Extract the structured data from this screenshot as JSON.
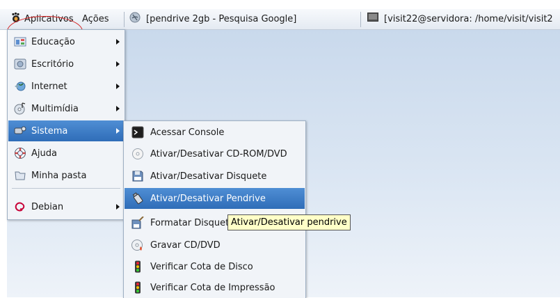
{
  "panel": {
    "apps_label": "Aplicativos",
    "actions_label": "Ações",
    "tasks": [
      {
        "label": "[pendrive 2gb - Pesquisa Google]",
        "icon": "browser-icon"
      },
      {
        "label": "[visit22@servidora: /home/visit/visit2",
        "icon": "terminal-icon"
      }
    ]
  },
  "menu": {
    "items": [
      {
        "label": "Educação",
        "icon": "education-icon",
        "submenu": true
      },
      {
        "label": "Escritório",
        "icon": "office-icon",
        "submenu": true
      },
      {
        "label": "Internet",
        "icon": "internet-icon",
        "submenu": true
      },
      {
        "label": "Multimídia",
        "icon": "multimedia-icon",
        "submenu": true
      },
      {
        "label": "Sistema",
        "icon": "system-icon",
        "submenu": true,
        "selected": true
      },
      {
        "label": "Ajuda",
        "icon": "help-icon",
        "submenu": false
      },
      {
        "label": "Minha pasta",
        "icon": "folder-icon",
        "submenu": false
      },
      {
        "label": "Debian",
        "icon": "debian-icon",
        "submenu": true
      }
    ]
  },
  "submenu": {
    "items": [
      {
        "label": "Acessar Console",
        "icon": "console-icon"
      },
      {
        "label": "Ativar/Desativar CD-ROM/DVD",
        "icon": "cdrom-icon"
      },
      {
        "label": "Ativar/Desativar Disquete",
        "icon": "floppy-icon"
      },
      {
        "label": "Ativar/Desativar Pendrive",
        "icon": "usb-drive-icon",
        "selected": true
      },
      {
        "label": "Formatar Disquete",
        "icon": "format-floppy-icon"
      },
      {
        "label": "Gravar CD/DVD",
        "icon": "burn-disc-icon"
      },
      {
        "label": "Verificar Cota de Disco",
        "icon": "traffic-light-icon"
      },
      {
        "label": "Verificar Cota de Impressão",
        "icon": "traffic-light-icon"
      }
    ]
  },
  "tooltip": {
    "text": "Ativar/Desativar pendrive"
  },
  "colors": {
    "selection": "#3a7cc8",
    "annotation_circle": "#d42020",
    "tooltip_bg": "#ffffc8"
  }
}
